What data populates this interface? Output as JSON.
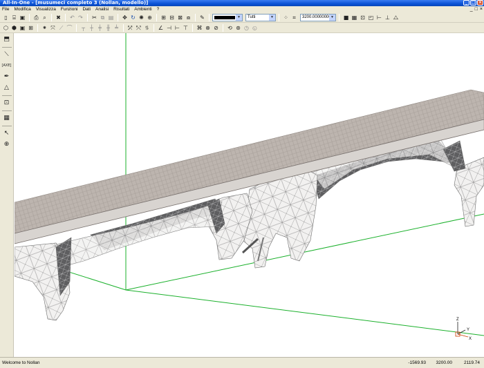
{
  "window": {
    "title": "All-In-One - [musumeci completo 3 (Nollan, modello)]",
    "controls": [
      "_",
      "□",
      "×"
    ]
  },
  "menu": {
    "items": [
      "File",
      "Modifica",
      "Visualizza",
      "Funzioni",
      "Dati",
      "Analisi",
      "Risultati",
      "Ambienti",
      "?"
    ],
    "mdi_controls": [
      "_",
      "□",
      "×"
    ]
  },
  "toolbar": {
    "layer_value": "Tutti",
    "distance_value": "3200.00000000",
    "line_color": "#000000"
  },
  "axis": {
    "z": "Z",
    "y": "Y",
    "x": "X"
  },
  "status": {
    "message": "Welcome to Nollan",
    "coord_x": "-1569.93",
    "coord_y": "3200.00",
    "coord_z": "2119.74"
  },
  "colors": {
    "titlebar": "#0a52d6",
    "chrome": "#ece9d8",
    "deck": "#b9b2ac",
    "guide_lines": "#19b02a",
    "mesh": "#5a5a5a"
  },
  "icons": {
    "left_toolbar": [
      "cube-icon",
      "line-icon",
      "axis-label-icon",
      "pen-icon",
      "support-icon",
      "dimension-icon",
      "grid-icon",
      "pointer-icon",
      "zoom-icon"
    ]
  }
}
